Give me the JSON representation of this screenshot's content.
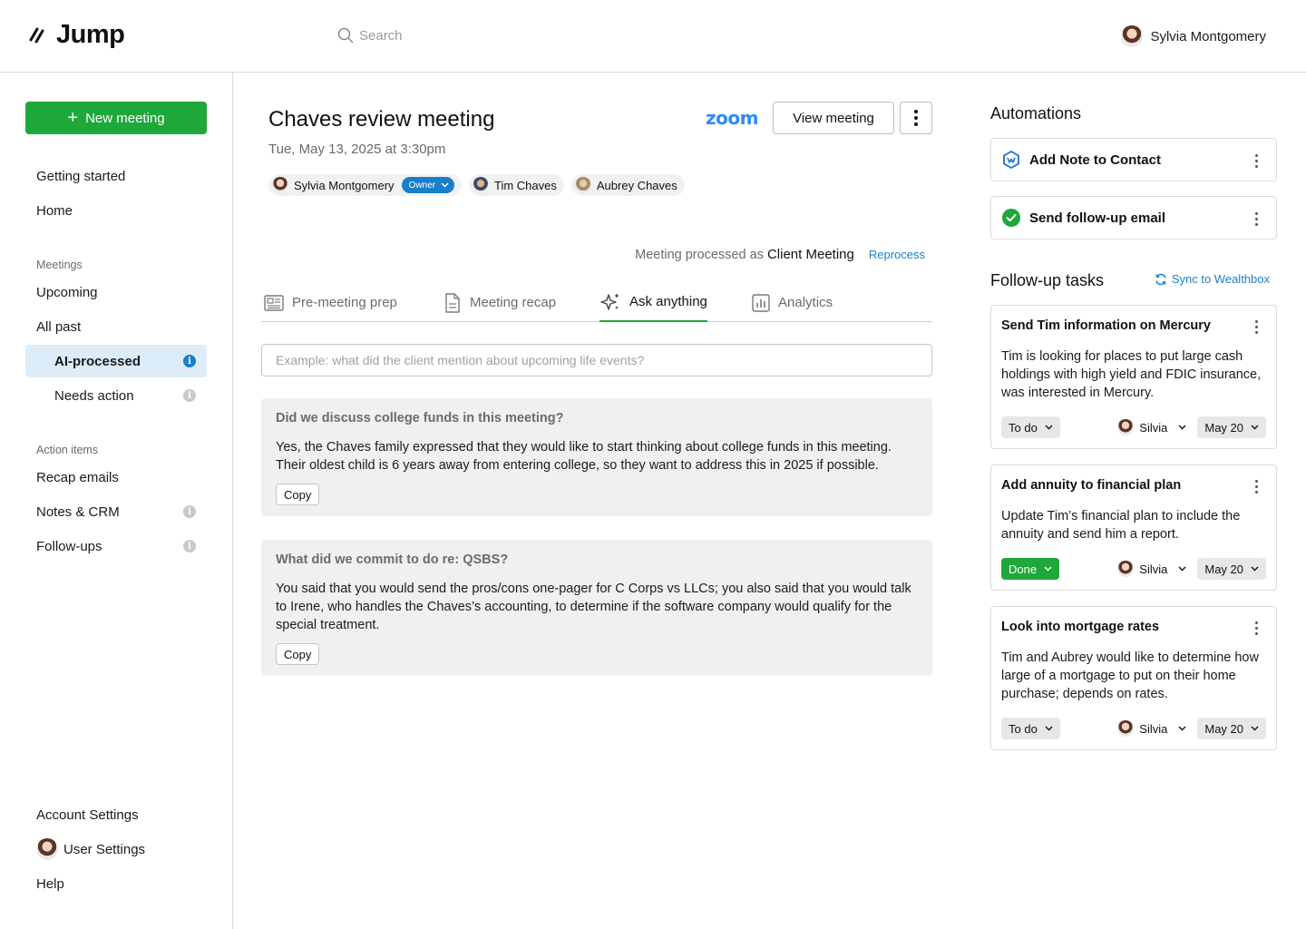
{
  "app": {
    "name": "Jump"
  },
  "header": {
    "search_placeholder": "Search",
    "user_name": "Sylvia Montgomery"
  },
  "sidebar": {
    "new_meeting_label": "New meeting",
    "top_items": [
      "Getting started",
      "Home"
    ],
    "meetings_section": "Meetings",
    "meetings_items": [
      "Upcoming",
      "All past",
      "AI-processed",
      "Needs action"
    ],
    "action_section": "Action items",
    "action_items": [
      "Recap emails",
      "Notes & CRM",
      "Follow-ups"
    ],
    "bottom_items": [
      "Account Settings",
      "User Settings",
      "Help"
    ]
  },
  "meeting": {
    "title": "Chaves review meeting",
    "datetime": "Tue, May 13, 2025 at 3:30pm",
    "zoom_label": "zoom",
    "view_button": "View meeting",
    "participants": [
      {
        "name": "Sylvia Montgomery",
        "badge": "Owner"
      },
      {
        "name": "Tim Chaves"
      },
      {
        "name": "Aubrey Chaves"
      }
    ],
    "processed_prefix": "Meeting processed as",
    "processed_kind": "Client Meeting",
    "reprocess_label": "Reprocess"
  },
  "tabs": [
    "Pre-meeting prep",
    "Meeting recap",
    "Ask anything",
    "Analytics"
  ],
  "active_tab": "Ask anything",
  "ask": {
    "placeholder": "Example: what did the client mention about upcoming life events?",
    "copy_label": "Copy",
    "qa": [
      {
        "question": "Did we discuss college funds in this meeting?",
        "answer": "Yes, the Chaves family expressed that they would like to start thinking about college funds in this meeting. Their oldest child is 6 years away from entering college, so they want to address this in 2025 if possible."
      },
      {
        "question": "What did we commit to do re: QSBS?",
        "answer": "You said that you would send the pros/cons one-pager for C Corps vs LLCs; you also said that you would talk to Irene, who handles the Chaves’s accounting, to determine if the software company would qualify for the special treatment."
      }
    ]
  },
  "automations": {
    "heading": "Automations",
    "items": [
      "Add Note to Contact",
      "Send follow-up email"
    ]
  },
  "followups": {
    "heading": "Follow-up tasks",
    "sync_label": "Sync to Wealthbox",
    "tasks": [
      {
        "title": "Send Tim information on Mercury",
        "description": "Tim is looking for places to put large cash holdings with high yield and FDIC insurance, was interested in Mercury.",
        "status": "To do",
        "assignee": "Silvia",
        "due": "May 20"
      },
      {
        "title": "Add annuity to financial plan",
        "description": "Update Tim’s financial plan to include the annuity and send him a report.",
        "status": "Done",
        "assignee": "Silvia",
        "due": "May 20"
      },
      {
        "title": "Look into mortgage rates",
        "description": "Tim and Aubrey would like to determine how large of a mortgage to put on their home purchase; depends on rates.",
        "status": "To do",
        "assignee": "Silvia",
        "due": "May 20"
      }
    ]
  },
  "colors": {
    "brand_green": "#1fa83a",
    "accent_blue": "#1a7fc9",
    "zoom_blue": "#2d8cff"
  }
}
